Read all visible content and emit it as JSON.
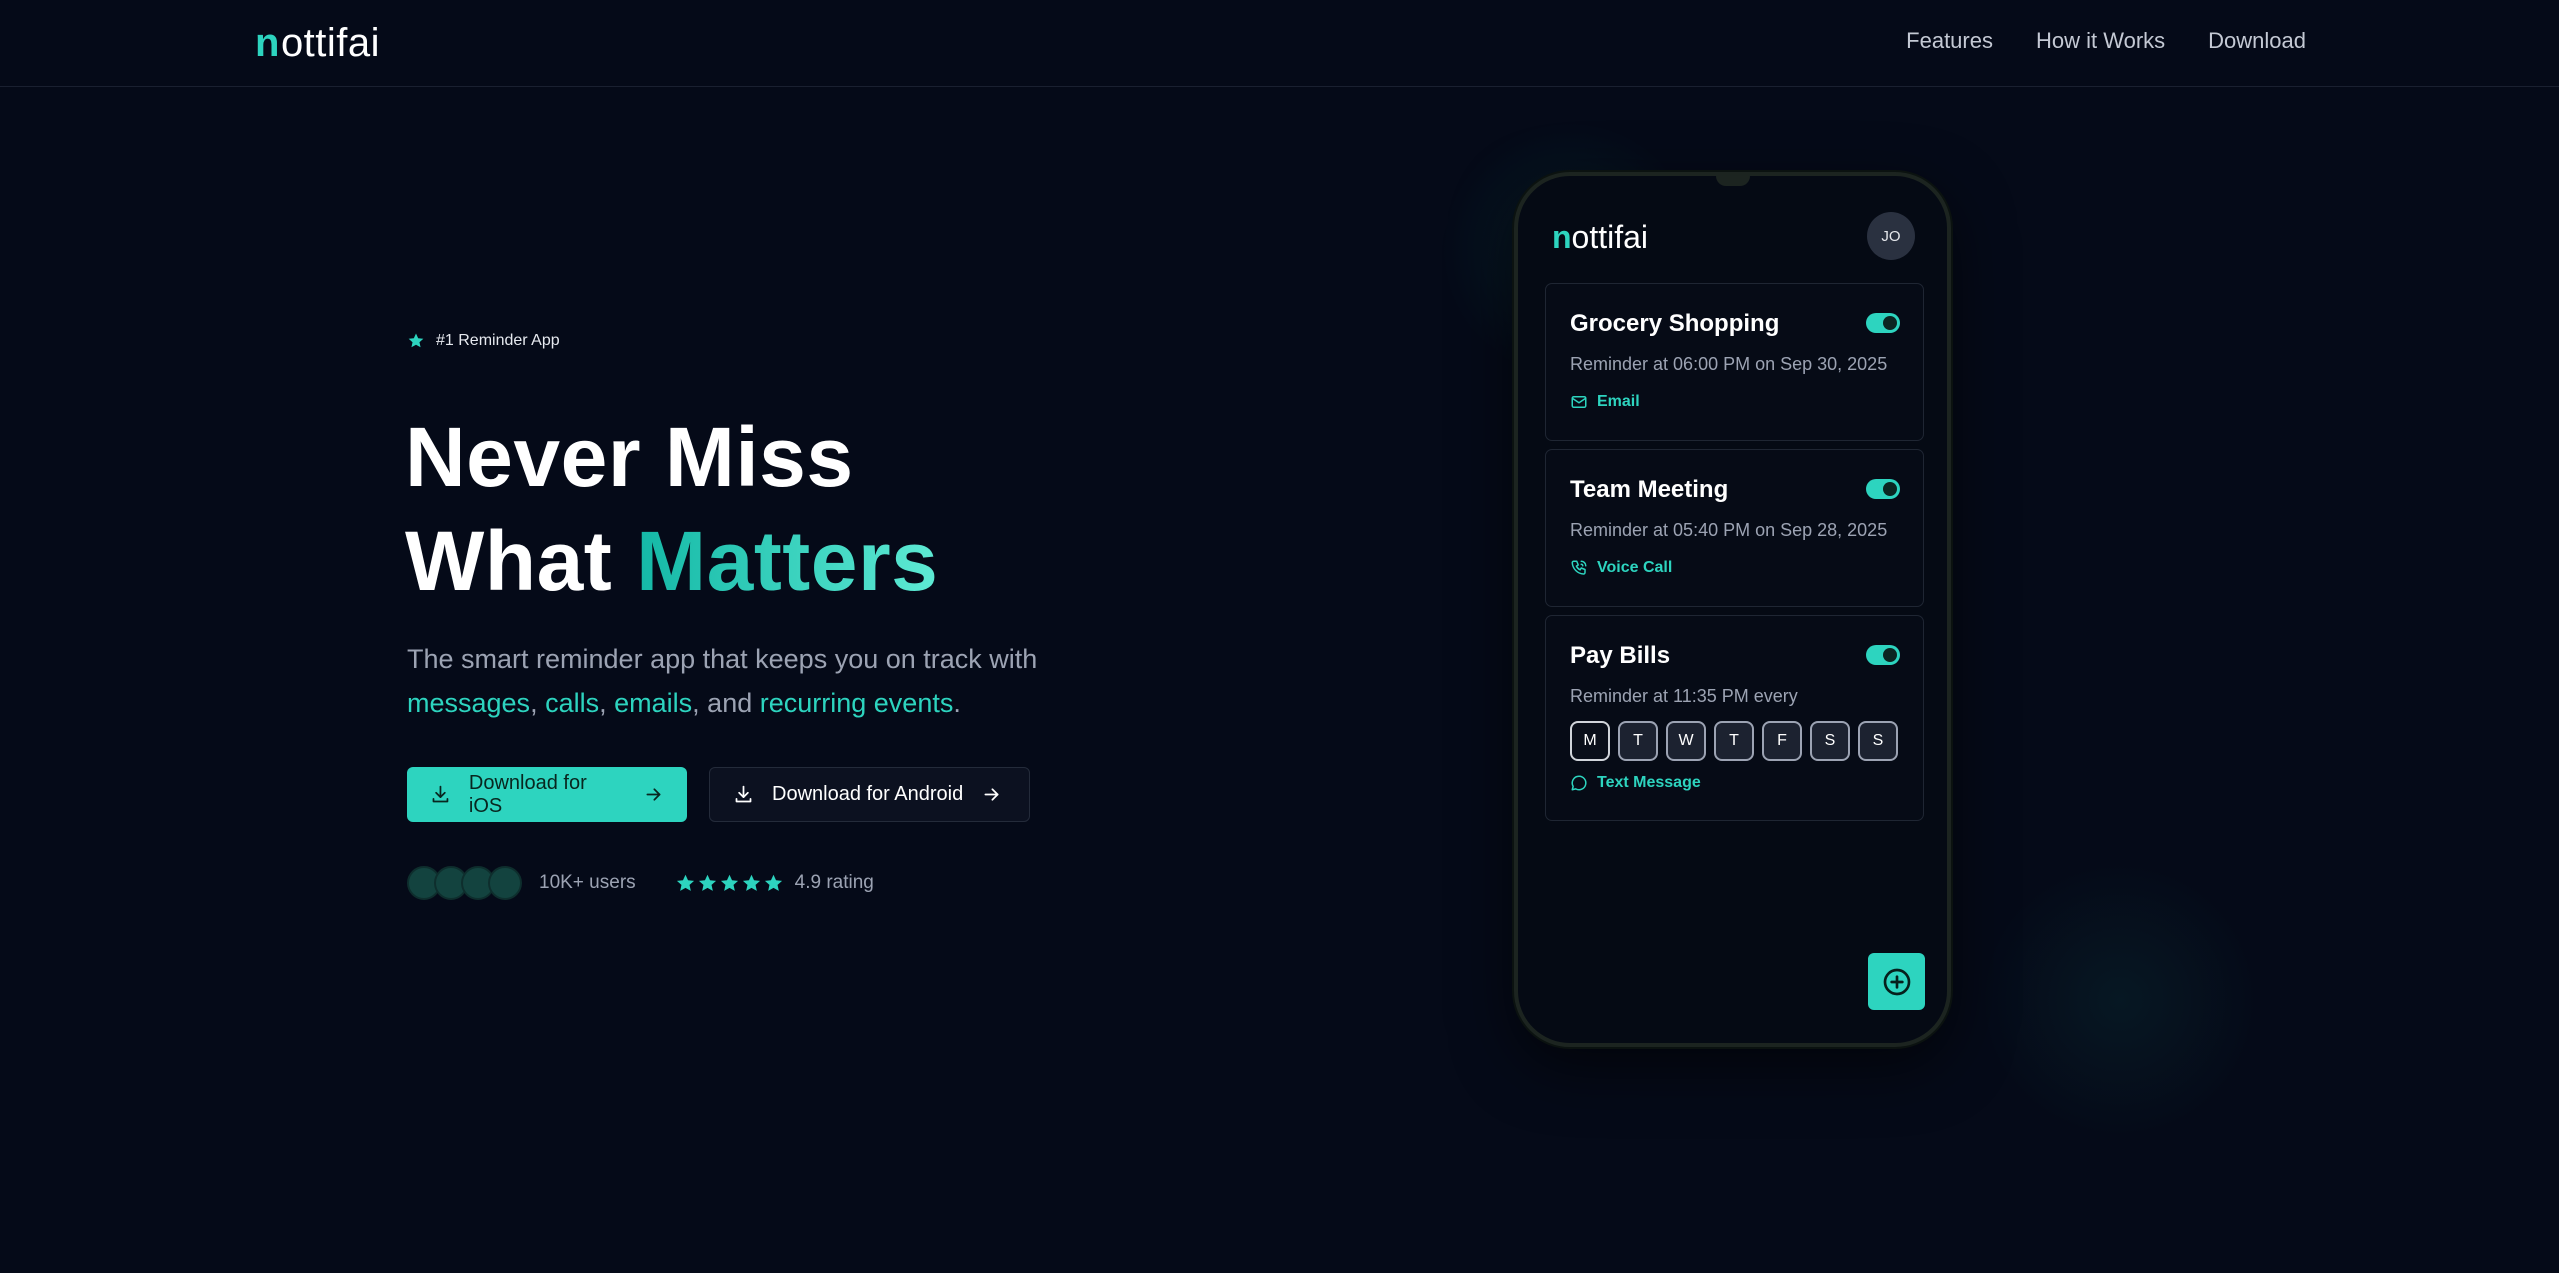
{
  "nav": {
    "brand_mark": "n",
    "brand_rest": "ottifai",
    "links": [
      "Features",
      "How it Works",
      "Download"
    ]
  },
  "hero": {
    "badge": "#1 Reminder App",
    "headline_line1": "Never Miss",
    "headline_line2_a": "What ",
    "headline_line2_b": "Matters",
    "subtitle_a": "The smart reminder app that keeps you on track with",
    "subtitle_messages": "messages",
    "subtitle_comma1": ",",
    "subtitle_calls": "calls",
    "subtitle_comma2": ",",
    "subtitle_emails": "emails",
    "subtitle_and": ", and",
    "subtitle_recurring": "recurring events",
    "subtitle_end": ".",
    "ios_button": "Download for iOS",
    "android_button": "Download for Android",
    "users": "10K+ users",
    "rating": "4.9 rating",
    "star_count": 5
  },
  "phone": {
    "brand_mark": "n",
    "brand_rest": "ottifai",
    "avatar": "JO",
    "cards": [
      {
        "title": "Grocery Shopping",
        "desc": "Reminder at 06:00 PM on Sep 30, 2025",
        "channel": "Email",
        "enabled": true
      },
      {
        "title": "Team Meeting",
        "desc": "Reminder at 05:40 PM on Sep 28, 2025",
        "channel": "Voice Call",
        "enabled": true
      },
      {
        "title": "Pay Bills",
        "desc": "Reminder at 11:35 PM every",
        "channel": "Text Message",
        "enabled": true,
        "days": [
          "M",
          "T",
          "W",
          "T",
          "F",
          "S",
          "S"
        ]
      }
    ]
  },
  "colors": {
    "accent": "#2dd4bf",
    "background": "#050a18",
    "muted_text": "#9ca3b3"
  }
}
